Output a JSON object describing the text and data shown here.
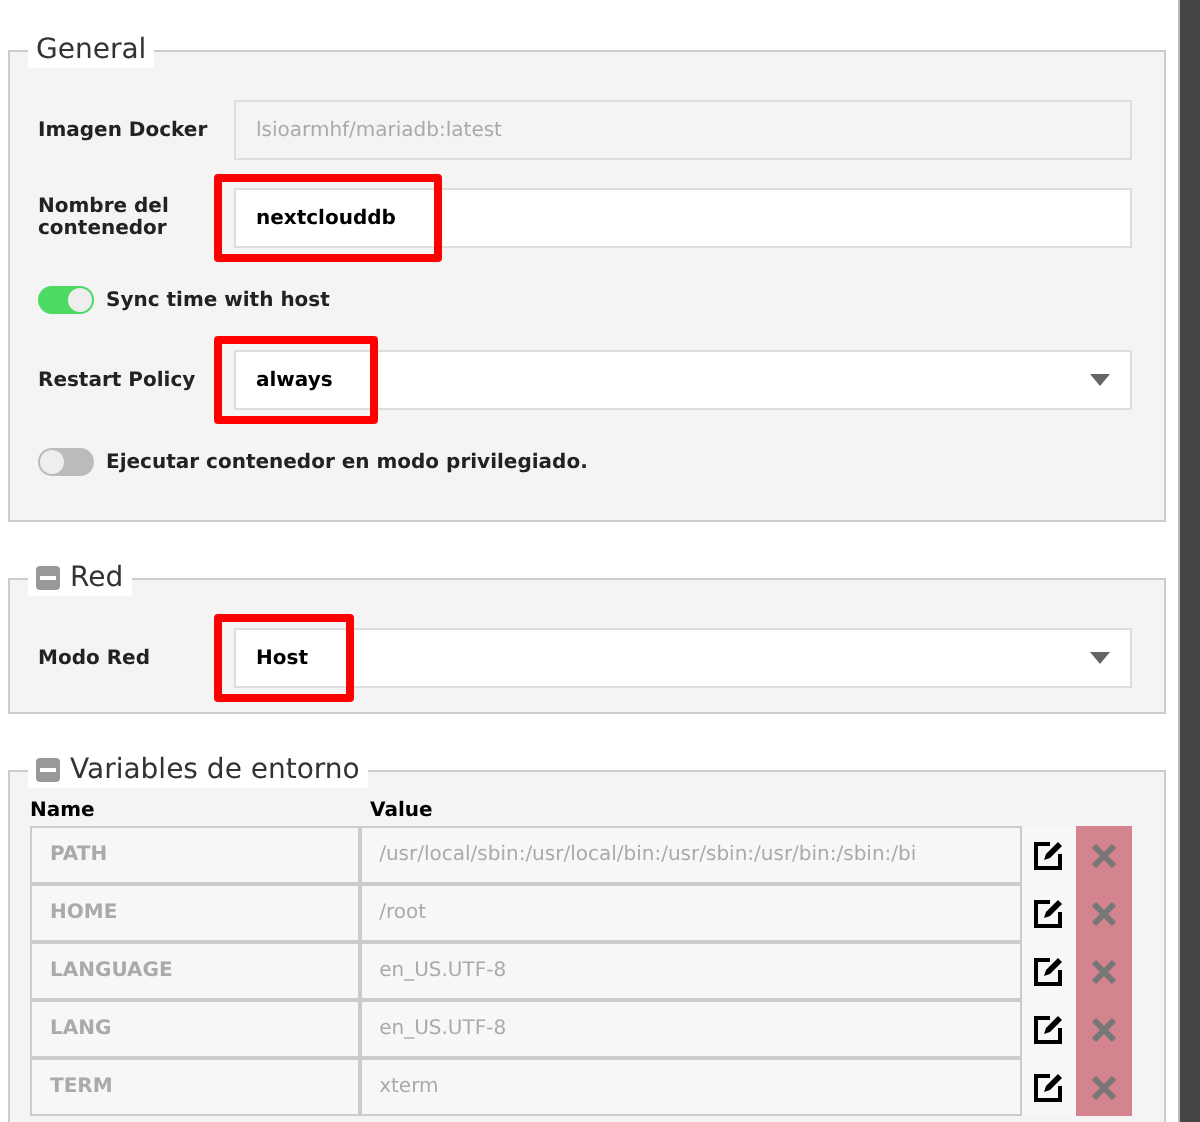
{
  "sections": [
    {
      "kind": "general",
      "title": "General",
      "rows": [
        {
          "kind": "input",
          "label": "Imagen Docker",
          "value": "lsioarmhf/mariadb:latest",
          "disabled": true,
          "highlighted": false
        },
        {
          "kind": "input",
          "label": "Nombre del contenedor",
          "value": "nextclouddb",
          "disabled": false,
          "highlighted": true
        },
        {
          "kind": "toggle",
          "label": "Sync time with host",
          "on": true
        },
        {
          "kind": "select",
          "label": "Restart Policy",
          "value": "always",
          "highlighted": true
        },
        {
          "kind": "toggle",
          "label": "Ejecutar contenedor en modo privilegiado.",
          "on": false
        }
      ]
    },
    {
      "kind": "general",
      "title": "Red",
      "collapsible": true,
      "rows": [
        {
          "kind": "select",
          "label": "Modo Red",
          "value": "Host",
          "highlighted": true
        }
      ]
    },
    {
      "kind": "table",
      "title": "Variables de entorno",
      "collapsible": true,
      "columns": [
        "Name",
        "Value"
      ],
      "rows": [
        {
          "name": "PATH",
          "value": "/usr/local/sbin:/usr/local/bin:/usr/sbin:/usr/bin:/sbin:/bi"
        },
        {
          "name": "HOME",
          "value": "/root"
        },
        {
          "name": "LANGUAGE",
          "value": "en_US.UTF-8"
        },
        {
          "name": "LANG",
          "value": "en_US.UTF-8"
        },
        {
          "name": "TERM",
          "value": "xterm"
        }
      ]
    }
  ]
}
